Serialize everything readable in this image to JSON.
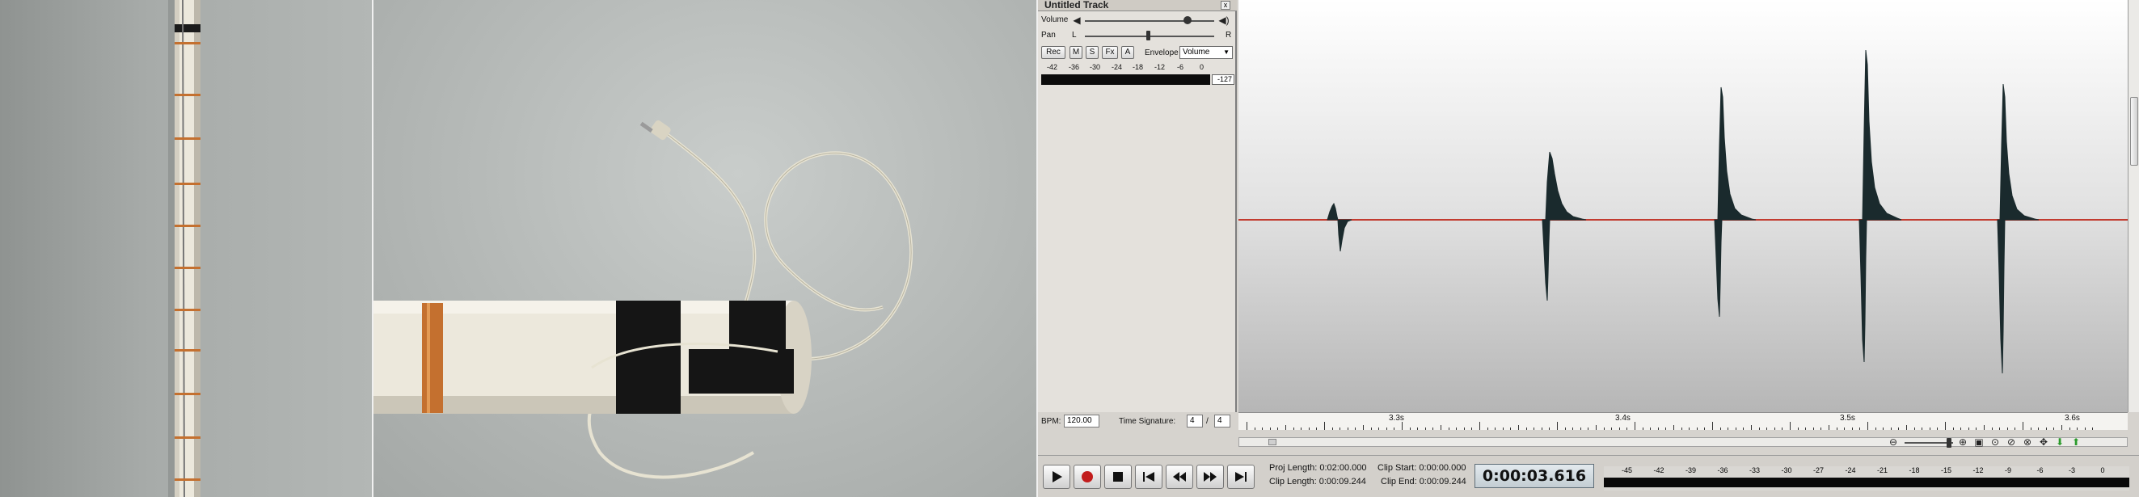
{
  "track": {
    "title": "Untitled Track",
    "close_glyph": "x",
    "volume_label": "Volume",
    "pan_label": "Pan",
    "pan_left": "L",
    "pan_right": "R",
    "buttons": {
      "rec": "Rec",
      "mute": "M",
      "solo": "S",
      "fx": "Fx",
      "automation": "A"
    },
    "envelope_label": "Envelope",
    "envelope_value": "Volume",
    "meter_ticks": [
      "-42",
      "-36",
      "-30",
      "-24",
      "-18",
      "-12",
      "-6",
      "0"
    ],
    "meter_value": "-127"
  },
  "bpm": {
    "label": "BPM:",
    "value": "120.00"
  },
  "time_signature": {
    "label": "Time Signature:",
    "numerator": "4",
    "separator": "/",
    "denominator": "4"
  },
  "ruler": {
    "labels": [
      "3.3s",
      "3.4s",
      "3.5s",
      "3.6s"
    ]
  },
  "project": {
    "proj_length": "Proj Length: 0:02:00.000",
    "clip_length": "Clip Length: 0:00:09.244",
    "clip_start": "Clip Start: 0:00:00.000",
    "clip_end": "Clip End: 0:00:09.244",
    "current_time": "0:00:03.616"
  },
  "output_meter": {
    "ticks": [
      "-45",
      "-42",
      "-39",
      "-36",
      "-33",
      "-30",
      "-27",
      "-24",
      "-21",
      "-18",
      "-15",
      "-12",
      "-9",
      "-6",
      "-3",
      "0"
    ]
  },
  "colors": {
    "waveform": "#1a2a2d",
    "baseline": "#c23b2f",
    "tape_copper": "#c4702f",
    "pipe": "#e8e4d8"
  },
  "icons": [
    "play-icon",
    "record-icon",
    "stop-icon",
    "skip-start-icon",
    "rewind-icon",
    "fast-forward-icon",
    "skip-end-icon",
    "zoom-out-icon",
    "zoom-in-icon",
    "speaker-icon"
  ]
}
